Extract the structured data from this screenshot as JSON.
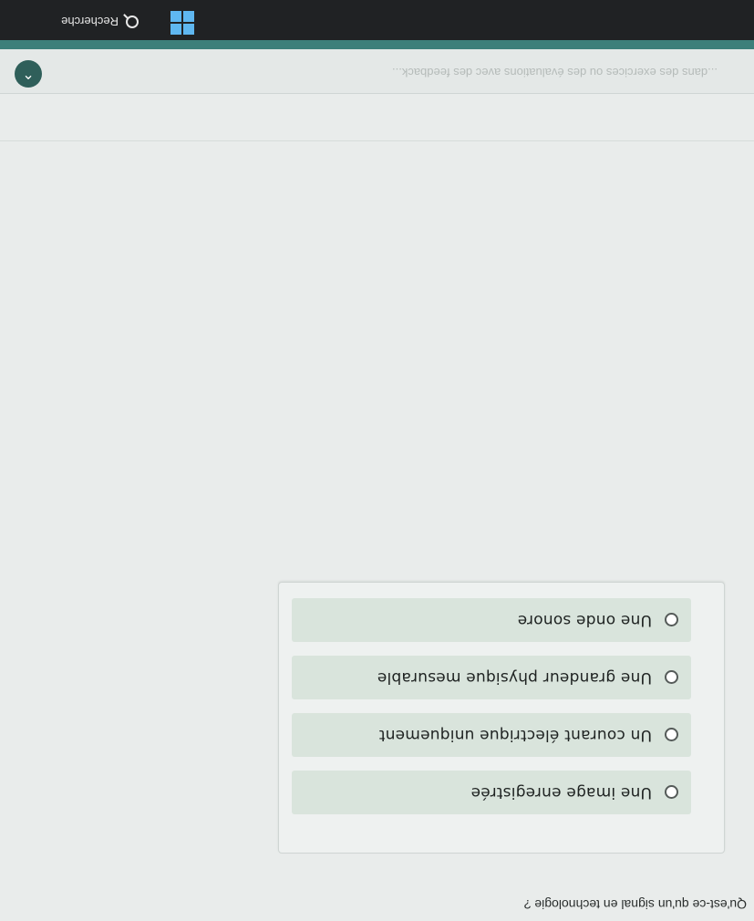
{
  "taskbar": {
    "search_label": "Recherche",
    "icons": [
      "windows-start-icon",
      "search-icon"
    ]
  },
  "page": {
    "header_faded_text": "...dans des exercices ou des évaluations avec des feedback..."
  },
  "quiz": {
    "question": "Qu'est-ce qu'un signal en technologie ?",
    "options": [
      {
        "label": "Une image enregistrée",
        "selected": false
      },
      {
        "label": "Un courant électrique uniquement",
        "selected": false
      },
      {
        "label": "Une grandeur physique mesurable",
        "selected": false
      },
      {
        "label": "Une onde sonore",
        "selected": false
      }
    ]
  },
  "colors": {
    "accent": "#3d7f7a",
    "option_bg": "#d9e4dc",
    "taskbar_bg": "#202224"
  }
}
